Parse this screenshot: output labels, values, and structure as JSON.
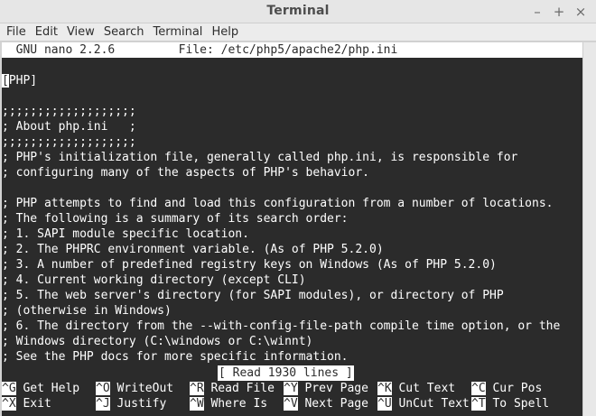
{
  "window": {
    "title": "Terminal"
  },
  "menubar": [
    "File",
    "Edit",
    "View",
    "Search",
    "Terminal",
    "Help"
  ],
  "nano": {
    "header": "  GNU nano 2.2.6         File: /etc/php5/apache2/php.ini",
    "cursor_char": "[",
    "first_line_rest": "PHP]",
    "lines": [
      "",
      ";;;;;;;;;;;;;;;;;;;",
      "; About php.ini   ;",
      ";;;;;;;;;;;;;;;;;;;",
      "; PHP's initialization file, generally called php.ini, is responsible for",
      "; configuring many of the aspects of PHP's behavior.",
      "",
      "; PHP attempts to find and load this configuration from a number of locations.",
      "; The following is a summary of its search order:",
      "; 1. SAPI module specific location.",
      "; 2. The PHPRC environment variable. (As of PHP 5.2.0)",
      "; 3. A number of predefined registry keys on Windows (As of PHP 5.2.0)",
      "; 4. Current working directory (except CLI)",
      "; 5. The web server's directory (for SAPI modules), or directory of PHP",
      "; (otherwise in Windows)",
      "; 6. The directory from the --with-config-file-path compile time option, or the",
      "; Windows directory (C:\\windows or C:\\winnt)",
      "; See the PHP docs for more specific information."
    ],
    "status": "[ Read 1930 lines ]",
    "shortcuts_row1": [
      {
        "key": "^G",
        "label": " Get Help"
      },
      {
        "key": "^O",
        "label": " WriteOut"
      },
      {
        "key": "^R",
        "label": " Read File"
      },
      {
        "key": "^Y",
        "label": " Prev Page"
      },
      {
        "key": "^K",
        "label": " Cut Text"
      },
      {
        "key": "^C",
        "label": " Cur Pos"
      }
    ],
    "shortcuts_row2": [
      {
        "key": "^X",
        "label": " Exit"
      },
      {
        "key": "^J",
        "label": " Justify"
      },
      {
        "key": "^W",
        "label": " Where Is"
      },
      {
        "key": "^V",
        "label": " Next Page"
      },
      {
        "key": "^U",
        "label": " UnCut Text"
      },
      {
        "key": "^T",
        "label": " To Spell"
      }
    ]
  }
}
